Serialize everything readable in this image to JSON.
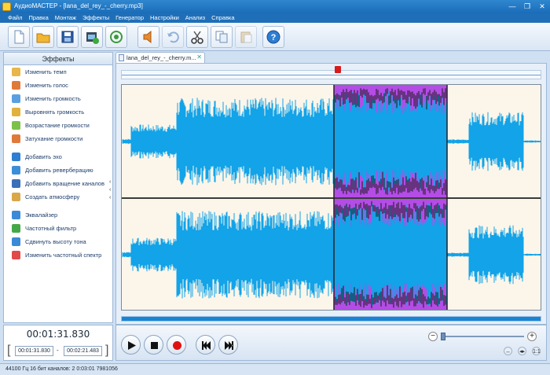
{
  "window": {
    "title": "АудиоМАСТЕР - [lana_del_rey_-_cherry.mp3]",
    "controls": [
      "—",
      "❐",
      "✕"
    ]
  },
  "menu": [
    "Файл",
    "Правка",
    "Монтаж",
    "Эффекты",
    "Генератор",
    "Настройки",
    "Анализ",
    "Справка"
  ],
  "toolbar": {
    "buttons": [
      {
        "name": "new-file-button",
        "icon": "new-document-icon"
      },
      {
        "name": "open-file-button",
        "icon": "folder-icon"
      },
      {
        "name": "save-button",
        "icon": "floppy-disk-icon"
      },
      {
        "name": "extract-audio-from-video-button",
        "icon": "film-icon"
      },
      {
        "name": "record-button",
        "icon": "refresh-record-icon"
      },
      {
        "name": "playback-settings-button",
        "icon": "speaker-icon"
      },
      {
        "name": "undo-button",
        "icon": "undo-icon"
      },
      {
        "name": "cut-button",
        "icon": "scissors-icon"
      },
      {
        "name": "copy-button",
        "icon": "copy-icon"
      },
      {
        "name": "paste-button",
        "icon": "paste-icon"
      },
      {
        "name": "help-button",
        "icon": "help-icon"
      }
    ]
  },
  "effects_panel": {
    "header": "Эффекты",
    "groups": [
      [
        {
          "label": "Изменить темп",
          "icon": "clock-icon",
          "color": "#e8b64a"
        },
        {
          "label": "Изменить голос",
          "icon": "person-icon",
          "color": "#e07a3a"
        },
        {
          "label": "Изменить громкость",
          "icon": "volume-icon",
          "color": "#5aa0e0"
        },
        {
          "label": "Выровнять громкость",
          "icon": "equalize-volume-icon",
          "color": "#e2b13a"
        },
        {
          "label": "Возрастание громкости",
          "icon": "fade-in-icon",
          "color": "#7cc24a"
        },
        {
          "label": "Затухание громкости",
          "icon": "fade-out-icon",
          "color": "#e07a3a"
        }
      ],
      [
        {
          "label": "Добавить эхо",
          "icon": "echo-icon",
          "color": "#2f7fd0"
        },
        {
          "label": "Добавить реверберацию",
          "icon": "reverb-icon",
          "color": "#3b8fd8"
        },
        {
          "label": "Добавить вращение каналов",
          "icon": "rotate-channels-icon",
          "color": "#3b6fb8"
        },
        {
          "label": "Создать атмосферу",
          "icon": "atmosphere-icon",
          "color": "#d8a84a"
        }
      ],
      [
        {
          "label": "Эквалайзер",
          "icon": "equalizer-icon",
          "color": "#3a8ad8"
        },
        {
          "label": "Частотный фильтр",
          "icon": "filter-icon",
          "color": "#44a848"
        },
        {
          "label": "Сдвинуть высоту тона",
          "icon": "pitch-icon",
          "color": "#3a8ad8"
        },
        {
          "label": "Изменить частотный спектр",
          "icon": "spectrum-icon",
          "color": "#e04a4a"
        }
      ]
    ]
  },
  "file_tab": {
    "label": "lana_del_rey_-_cherry.m...",
    "close": "✕"
  },
  "waveform": {
    "wave_color": "#12a3e8",
    "selection_color": "#b44ce6",
    "background_color": "#fcf6ea",
    "selection": {
      "start": "00:01:31.830",
      "end": "00:02:21.483"
    },
    "channels": 2
  },
  "time": {
    "current": "00:01:31.830",
    "selection_start": "00:01:31.830",
    "selection_end": "00:02:21.483",
    "separator": "-"
  },
  "zoom": {
    "minus": "−",
    "plus": "+",
    "icons": [
      "↔",
      "◂▸",
      "1:1"
    ]
  },
  "status": {
    "text": "44100 Гц  16 бит  каналов: 2    0:03:01 7981056"
  }
}
